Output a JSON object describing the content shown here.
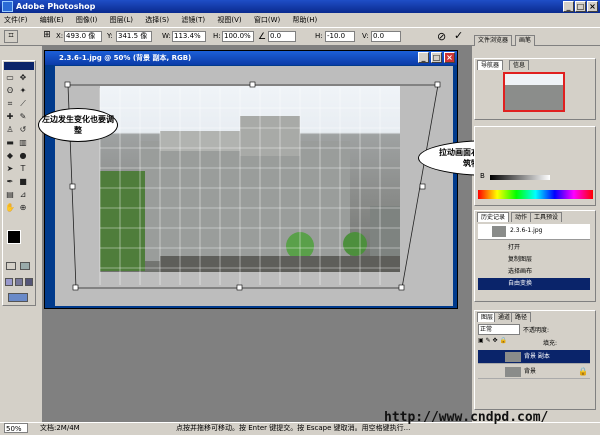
{
  "app": {
    "title": "Adobe Photoshop"
  },
  "menu": [
    "文件(F)",
    "编辑(E)",
    "图像(I)",
    "图层(L)",
    "选择(S)",
    "滤镜(T)",
    "视图(V)",
    "窗口(W)",
    "帮助(H)"
  ],
  "options": {
    "x_label": "X:",
    "x_value": "493.0 像",
    "y_label": "Y:",
    "y_value": "341.5 像",
    "w_label": "W:",
    "w_value": "113.4%",
    "h_label": "H:",
    "h_value": "100.0%",
    "angle_value": "0.0",
    "hskew_label": "H:",
    "hskew_value": "-10.0",
    "vskew_label": "V:",
    "vskew_value": "0.0",
    "tab_browser": "文件浏览器",
    "tab_brush": "画笔"
  },
  "document": {
    "title": "2.3.6-1.jpg @ 50% (背景 副本, RGB)"
  },
  "annotations": {
    "left": "左边发生变化也要调整",
    "right": "拉动画面右顶部的节点调整建筑物的右半部分"
  },
  "navigator": {
    "tab_nav": "导航器",
    "tab_info": "信息"
  },
  "color_panel": {
    "label_b": "B"
  },
  "history": {
    "tab_history": "历史记录",
    "tab_actions": "动作",
    "tab_tools": "工具预设",
    "snapshot": "2.3.6-1.jpg",
    "items": [
      "打开",
      "复制图层",
      "选择画布",
      "自由变换"
    ]
  },
  "layers": {
    "tab_layers": "图层",
    "tab_channels": "通道",
    "tab_paths": "路径",
    "mode": "正常",
    "opacity_label": "不透明度:",
    "fill_label": "填充:",
    "items": [
      "背景 副本",
      "背景"
    ]
  },
  "status": {
    "zoom": "50%",
    "doc": "文档:2M/4M",
    "hint": "点按并拖移可移动。按 Enter 键提交。按 Escape 键取消。用空格键执行..."
  },
  "watermark": "http://www.cndpd.com/"
}
